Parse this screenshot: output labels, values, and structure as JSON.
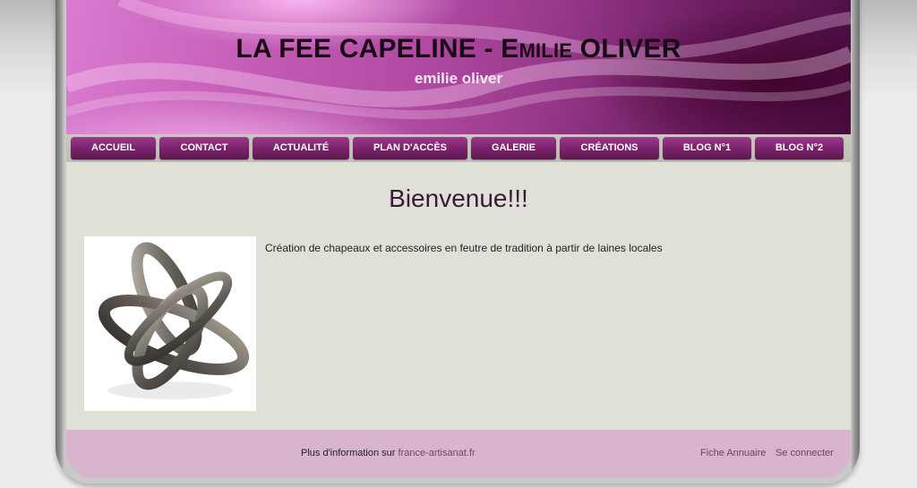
{
  "header": {
    "title_main": "LA FEE CAPELINE - E",
    "title_smallcaps": "MILIE",
    "title_end": " OLIVER",
    "subtitle": "emilie oliver"
  },
  "nav": {
    "items": [
      {
        "label": "ACCUEIL"
      },
      {
        "label": "CONTACT"
      },
      {
        "label": "ACTUALITÉ"
      },
      {
        "label": "PLAN D'ACCÈS"
      },
      {
        "label": "GALERIE"
      },
      {
        "label": "CRÉATIONS"
      },
      {
        "label": "BLOG N°1"
      },
      {
        "label": "BLOG N°2"
      }
    ]
  },
  "main": {
    "heading": "Bienvenue!!!",
    "intro_text": "Création de chapeaux et accessoires en feutre de tradition à partir de laines locales",
    "image_icon": "sculpture-photo"
  },
  "footer": {
    "info_prefix": "Plus d'information sur ",
    "info_link": "france-artisanat.fr",
    "links": [
      {
        "label": "Fiche Annuaire"
      },
      {
        "label": "Se connecter"
      }
    ]
  },
  "colors": {
    "accent": "#80246f",
    "banner": "#b04aa2",
    "content_bg": "#dfe0d8",
    "footer_bg": "#d9b4cf",
    "heading": "#3a1a35"
  }
}
